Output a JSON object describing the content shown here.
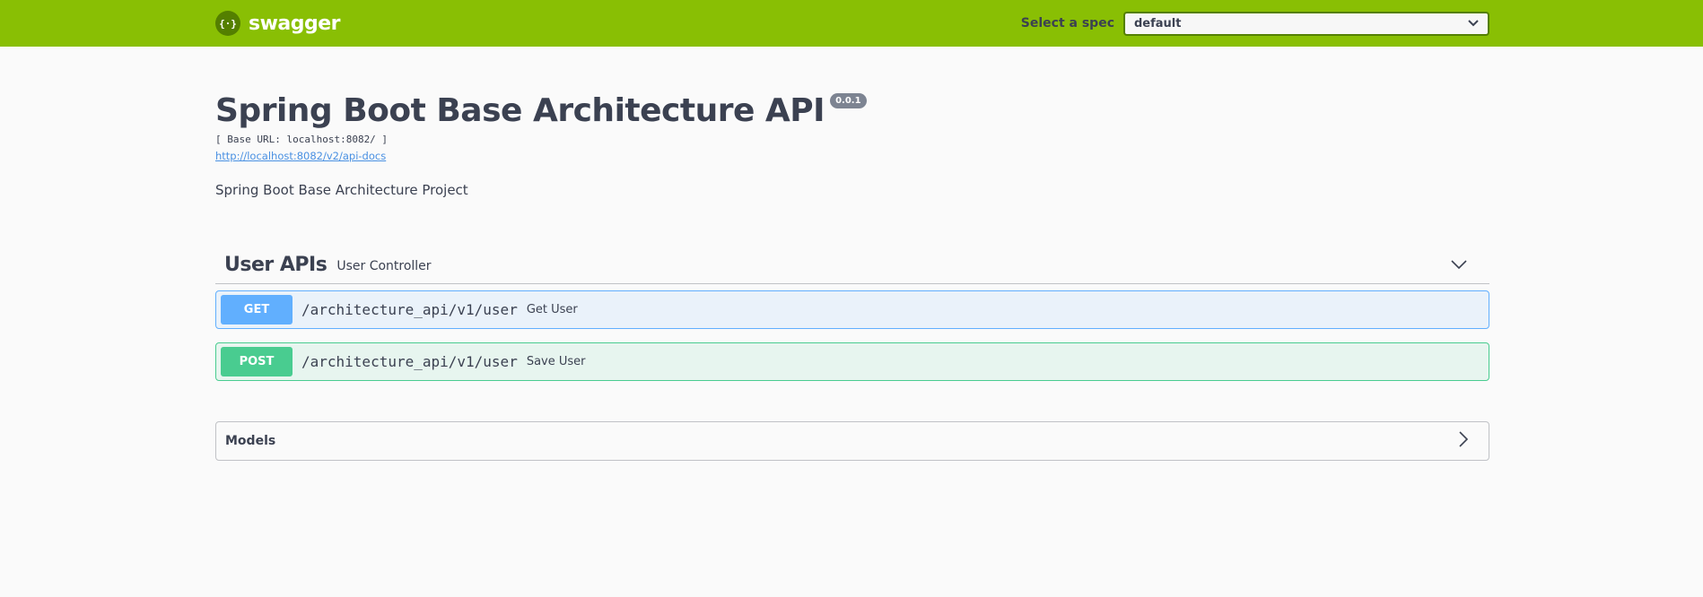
{
  "topbar": {
    "brand": "swagger",
    "spec_label": "Select a spec",
    "spec_value": "default",
    "brand_color": "#89bf04"
  },
  "info": {
    "title": "Spring Boot Base Architecture API",
    "version": "0.0.1",
    "base_url": "[ Base URL: localhost:8082/ ]",
    "spec_link": "http://localhost:8082/v2/api-docs",
    "description": "Spring Boot Base Architecture Project"
  },
  "tag": {
    "name": "User APIs",
    "description": "User Controller",
    "operations": [
      {
        "method": "GET",
        "path": "/architecture_api/v1/user",
        "summary": "Get User",
        "color": "#61affe"
      },
      {
        "method": "POST",
        "path": "/architecture_api/v1/user",
        "summary": "Save User",
        "color": "#49cc90"
      }
    ]
  },
  "models": {
    "title": "Models"
  }
}
